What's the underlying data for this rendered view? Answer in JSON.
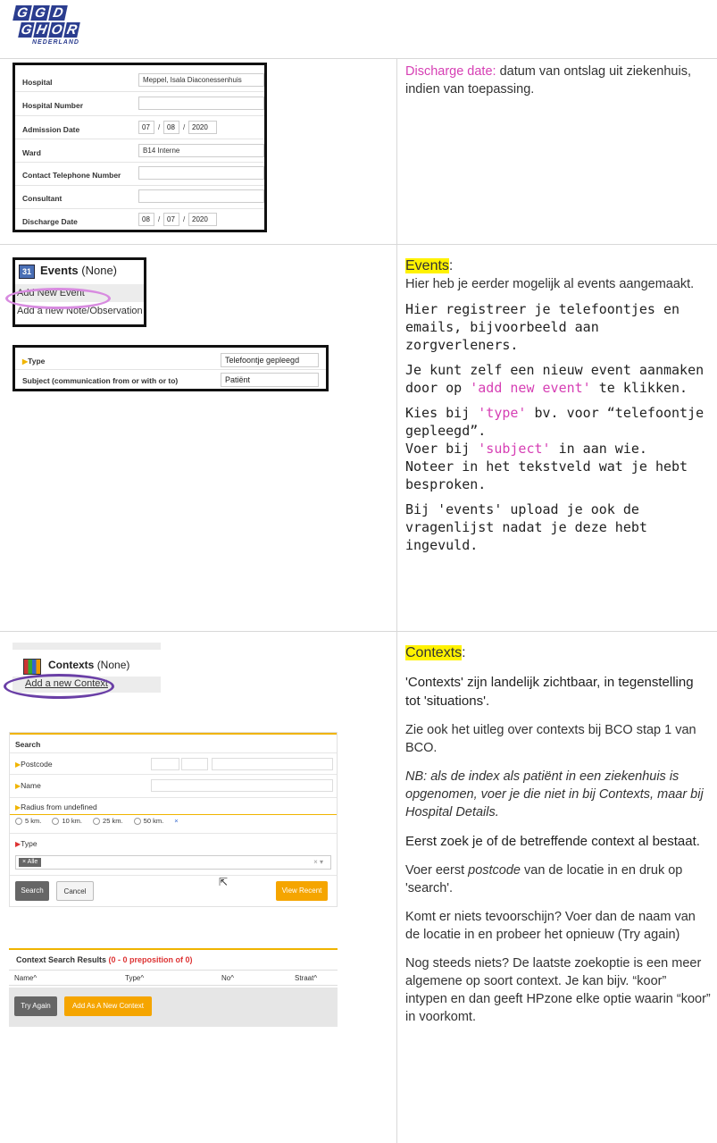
{
  "logo": {
    "row1": [
      "G",
      "G",
      "D"
    ],
    "row2": [
      "G",
      "H",
      "O",
      "R"
    ],
    "sub": "NEDERLAND"
  },
  "hospital_form": {
    "rows": [
      {
        "label": "Hospital",
        "value": "Meppel, Isala Diaconessenhuis"
      },
      {
        "label": "Hospital Number",
        "value": ""
      },
      {
        "label": "Admission Date",
        "date": [
          "07",
          "08",
          "2020"
        ]
      },
      {
        "label": "Ward",
        "value": "B14 Interne"
      },
      {
        "label": "Contact Telephone Number",
        "value": ""
      },
      {
        "label": "Consultant",
        "value": ""
      },
      {
        "label": "Discharge Date",
        "date": [
          "08",
          "07",
          "2020"
        ]
      }
    ]
  },
  "row1_text": {
    "term": "Discharge date:",
    "rest": " datum van ontslag uit ziekenhuis, indien van toepassing."
  },
  "events_panel": {
    "title": "Events",
    "count": "(None)",
    "add_event": "Add New Event",
    "add_note": "Add a new Note/Observation"
  },
  "event_form": {
    "rows": [
      {
        "label": "Type",
        "value": "Telefoontje gepleegd"
      },
      {
        "label": "Subject (communication from or with or to)",
        "value": "Patiënt"
      }
    ]
  },
  "row2_text": {
    "heading": "Events",
    "heading_colon": ":",
    "intro": "Hier heb je eerder mogelijk al events aangemaakt.",
    "p1": "Hier registreer je telefoontjes en emails, bijvoorbeeld aan zorgverleners.",
    "p2_a": "Je kunt zelf een nieuw event aanmaken door op ",
    "p2_pink": "'add new event'",
    "p2_b": " te klikken.",
    "p3_a": "Kies bij ",
    "p3_pink1": "'type'",
    "p3_b": " bv. voor “telefoontje gepleegd”.",
    "p3_c": "Voer bij ",
    "p3_pink2": "'subject'",
    "p3_d": " in aan wie.",
    "p3_e": "Noteer in het tekstveld wat je hebt besproken.",
    "p4": "Bij 'events' upload je ook de vragenlijst nadat je deze hebt ingevuld."
  },
  "contexts_panel": {
    "title": "Contexts",
    "count": "(None)",
    "add": "Add a new Context"
  },
  "search_panel": {
    "title": "Search",
    "postcode": "Postcode",
    "name": "Name",
    "radius": "Radius from undefined",
    "radius_options": [
      "5 km.",
      "10 km.",
      "25 km.",
      "50 km."
    ],
    "radius_clear": "×",
    "type": "Type",
    "type_chip": "× Alle",
    "type_clear": "× ▾",
    "search_button": "Search",
    "cancel_button": "Cancel",
    "recent_button": "View Recent"
  },
  "results_panel": {
    "title": "Context Search Results",
    "count": "(0 - 0 preposition of 0)",
    "columns": [
      "Name^",
      "Type^",
      "No^",
      "Straat^"
    ],
    "try_again": "Try Again",
    "add_new": "Add As A New Context"
  },
  "row3_text": {
    "heading": "Contexts",
    "heading_colon": ":",
    "p1": "'Contexts' zijn landelijk zichtbaar, in tegenstelling tot 'situations'.",
    "p2": "Zie ook het uitleg over contexts bij BCO stap 1 van BCO.",
    "p3": "NB: als de index als patiënt in een ziekenhuis is opgenomen, voer je die niet in bij Contexts, maar bij Hospital Details.",
    "p4": "Eerst zoek je of de betreffende context al bestaat.",
    "p5_a": "Voer eerst ",
    "p5_em": "postcode",
    "p5_b": " van de locatie in en druk op 'search'.",
    "p6": "Komt er niets tevoorschijn? Voer dan de naam van de locatie in en probeer het opnieuw (Try again)",
    "p7": "Nog steeds niets? De laatste zoekoptie is een meer algemene op soort context. Je kan bijv. “koor” intypen en dan geeft HPzone elke optie waarin “koor” in voorkomt."
  }
}
